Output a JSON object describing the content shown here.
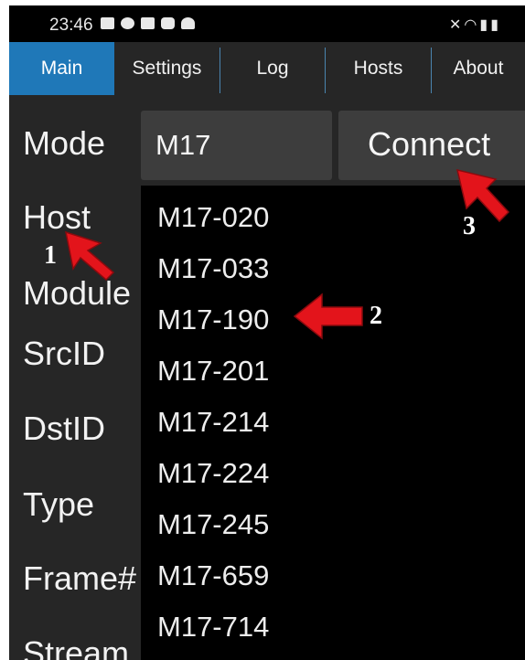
{
  "status_bar": {
    "time": "23:46",
    "icons": [
      "image-icon",
      "facebook-icon",
      "gallery-icon",
      "youtube-icon",
      "weather-icon"
    ],
    "right_icons": [
      "mute-icon",
      "wifi-icon",
      "signal-icon",
      "battery-icon"
    ]
  },
  "tabs": [
    {
      "label": "Main",
      "active": true
    },
    {
      "label": "Settings",
      "active": false
    },
    {
      "label": "Log",
      "active": false
    },
    {
      "label": "Hosts",
      "active": false
    },
    {
      "label": "About",
      "active": false
    }
  ],
  "colors": {
    "accent": "#1f78b8",
    "background": "#262626",
    "dropdown_bg": "#000000",
    "annotation_red": "#e3141b"
  },
  "form": {
    "labels": {
      "mode": "Mode",
      "host": "Host",
      "module": "Module",
      "srcid": "SrcID",
      "dstid": "DstID",
      "type": "Type",
      "frame": "Frame#",
      "stream": "Stream"
    },
    "mode_value": "M17",
    "connect_label": "Connect"
  },
  "dropdown": {
    "items": [
      "M17-020",
      "M17-033",
      "M17-190",
      "M17-201",
      "M17-214",
      "M17-224",
      "M17-245",
      "M17-659",
      "M17-714"
    ]
  },
  "annotations": {
    "n1": "1",
    "n2": "2",
    "n3": "3"
  }
}
